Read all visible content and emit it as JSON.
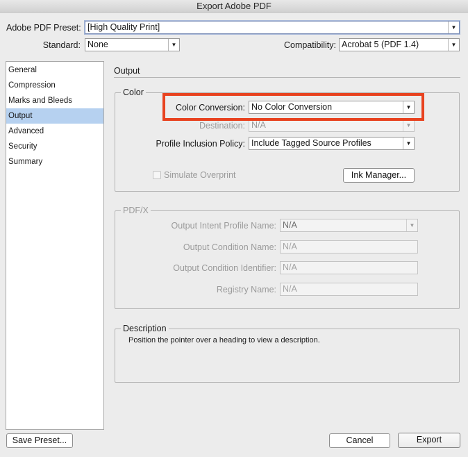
{
  "window": {
    "title": "Export Adobe PDF"
  },
  "preset": {
    "label": "Adobe PDF Preset:",
    "value": "[High Quality Print]"
  },
  "standard": {
    "label": "Standard:",
    "value": "None"
  },
  "compatibility": {
    "label": "Compatibility:",
    "value": "Acrobat 5 (PDF 1.4)"
  },
  "sidebar": {
    "items": [
      {
        "label": "General"
      },
      {
        "label": "Compression"
      },
      {
        "label": "Marks and Bleeds"
      },
      {
        "label": "Output"
      },
      {
        "label": "Advanced"
      },
      {
        "label": "Security"
      },
      {
        "label": "Summary"
      }
    ],
    "selected": "Output"
  },
  "panel": {
    "title": "Output"
  },
  "color_group": {
    "title": "Color",
    "color_conversion": {
      "label": "Color Conversion:",
      "value": "No Color Conversion"
    },
    "destination": {
      "label": "Destination:",
      "value": "N/A"
    },
    "profile_inclusion": {
      "label": "Profile Inclusion Policy:",
      "value": "Include Tagged Source Profiles"
    },
    "simulate_overprint": {
      "label": "Simulate Overprint",
      "checked": false
    },
    "ink_manager_label": "Ink Manager..."
  },
  "pdfx_group": {
    "title": "PDF/X",
    "output_intent": {
      "label": "Output Intent Profile Name:",
      "value": "N/A"
    },
    "output_condition_name": {
      "label": "Output Condition Name:",
      "value": "N/A"
    },
    "output_condition_identifier": {
      "label": "Output Condition Identifier:",
      "value": "N/A"
    },
    "registry_name": {
      "label": "Registry Name:",
      "value": "N/A"
    }
  },
  "description_group": {
    "title": "Description",
    "text": "Position the pointer over a heading to view a description."
  },
  "footer": {
    "save_preset_label": "Save Preset...",
    "cancel_label": "Cancel",
    "export_label": "Export"
  },
  "colors": {
    "highlight": "#e8421f",
    "selection": "#b6d1f0"
  },
  "icons": {
    "dropdown_arrow": "chevron-down-icon"
  }
}
